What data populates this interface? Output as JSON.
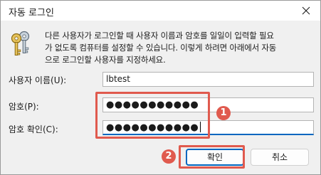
{
  "window": {
    "title": "자동 로그인"
  },
  "description": {
    "line1": "다른 사용자가 로그인할 때 사용자 이름과 암호를 일일이 입력할 필요",
    "line2": "가 없도록 컴퓨터를 설정할 수 있습니다. 이렇게 하려면 아래에서 자동",
    "line3": "으로 로그인할 사용자를 지정하세요."
  },
  "form": {
    "username_label": "사용자 이름(U):",
    "username_value": "lbtest",
    "password_label": "암호(P):",
    "password_value": "●●●●●●●●●●●",
    "confirm_label": "암호 확인(C):",
    "confirm_value": "●●●●●●●●●●●"
  },
  "buttons": {
    "ok_label": "확인",
    "cancel_label": "취소"
  },
  "annotations": {
    "step1": "1",
    "step2": "2",
    "highlight_color": "#e05a4e"
  },
  "icons": {
    "close": "close-icon",
    "keys": "keys-icon"
  },
  "colors": {
    "accent": "#0067c0",
    "dialog_bg": "#f0f0f0"
  }
}
